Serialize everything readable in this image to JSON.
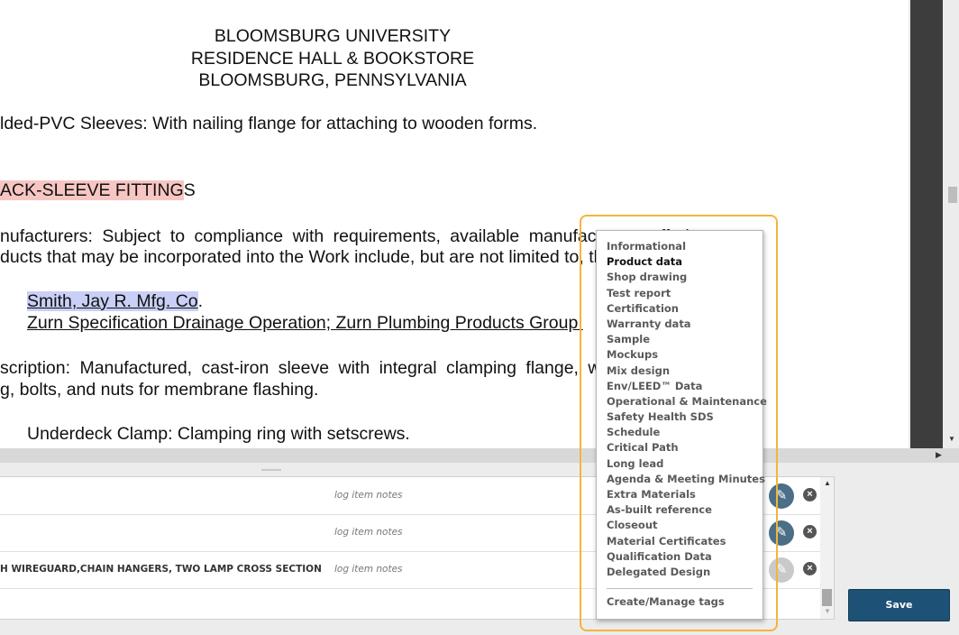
{
  "document": {
    "header": [
      "BLOOMSBURG UNIVERSITY",
      "RESIDENCE HALL & BOOKSTORE",
      "BLOOMSBURG, PENNSYLVANIA"
    ],
    "line_sleeves": "lded-PVC Sleeves:  With nailing flange for attaching to wooden forms.",
    "section_highlighted": "ACK-SLEEVE FITTING",
    "section_tail": "S",
    "manufacturers_1": "nufacturers:  Subject to compliance with requirements, available manufacturers offering",
    "manufacturers_2": "ducts that may be incorporated into the Work include, but are not limited to, the following:",
    "mfr_a": "Smith, Jay R. Mfg. Co",
    "mfr_a_tail": ".",
    "mfr_b": "Zurn Specification Drainage Operation; Zurn Plumbing Products Group.",
    "description_1": "scription:  Manufactured, cast-iron sleeve with integral clamping flange, with clamping",
    "description_2": "g, bolts, and nuts for membrane flashing.",
    "clamp": "Underdeck Clamp:  Clamping ring with setscrews."
  },
  "log_table": {
    "rows": [
      {
        "title": "",
        "notes": "log item notes",
        "tag_state": "active"
      },
      {
        "title": "",
        "notes": "log item notes",
        "tag_state": "active"
      },
      {
        "title": "H WIREGUARD,CHAIN HANGERS, TWO LAMP CROSS SECTION",
        "notes": "log item notes",
        "tag_state": "inactive"
      }
    ]
  },
  "save_label": "Save",
  "tag_menu": {
    "items": [
      "Informational",
      "Product data",
      "Shop drawing",
      "Test report",
      "Certification",
      "Warranty data",
      "Sample",
      "Mockups",
      "Mix design",
      "Env/LEED™ Data",
      "Operational & Maintenance",
      "Safety Health SDS",
      "Schedule",
      "Critical Path",
      "Long lead",
      "Agenda & Meeting Minutes",
      "Extra Materials",
      "As-built reference",
      "Closeout",
      "Material Certificates",
      "Qualification Data",
      "Delegated Design"
    ],
    "selected": "Product data",
    "manage_label": "Create/Manage tags"
  },
  "icons": {
    "tag": "tag-icon",
    "remove": "close-circle-icon"
  },
  "colors": {
    "save_button": "#1d5175",
    "tag_active": "#4a6f86",
    "tag_inactive": "#c9c9c9",
    "focus_ring": "#f5b43c",
    "highlight_red": "#f7c6c3",
    "highlight_blue": "#c9cff6"
  }
}
